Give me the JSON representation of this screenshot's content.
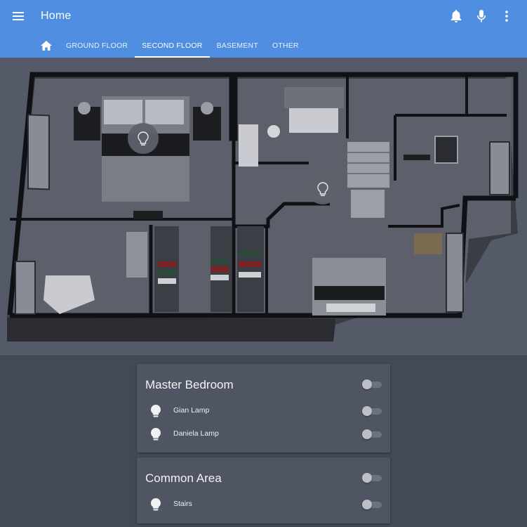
{
  "header": {
    "title": "Home",
    "tabs": [
      {
        "label": "Ground Floor",
        "active": false
      },
      {
        "label": "Second Floor",
        "active": true
      },
      {
        "label": "Basement",
        "active": false
      },
      {
        "label": "Other",
        "active": false
      }
    ],
    "icons": [
      "menu-icon",
      "bell-icon",
      "microphone-icon",
      "more-vert-icon",
      "home-icon"
    ],
    "colors": {
      "accent": "#4f8ee0",
      "background": "#434956",
      "card": "#4f5563"
    }
  },
  "floorplan": {
    "light_markers": [
      "lightbulb-icon",
      "lightbulb-icon"
    ]
  },
  "cards": [
    {
      "title": "Master Bedroom",
      "group_toggle_on": false,
      "entities": [
        {
          "name": "Gian Lamp",
          "icon": "lightbulb-icon",
          "on": false
        },
        {
          "name": "Daniela Lamp",
          "icon": "lightbulb-icon",
          "on": false
        }
      ]
    },
    {
      "title": "Common Area",
      "group_toggle_on": false,
      "entities": [
        {
          "name": "Stairs",
          "icon": "lightbulb-icon",
          "on": false
        }
      ]
    }
  ]
}
